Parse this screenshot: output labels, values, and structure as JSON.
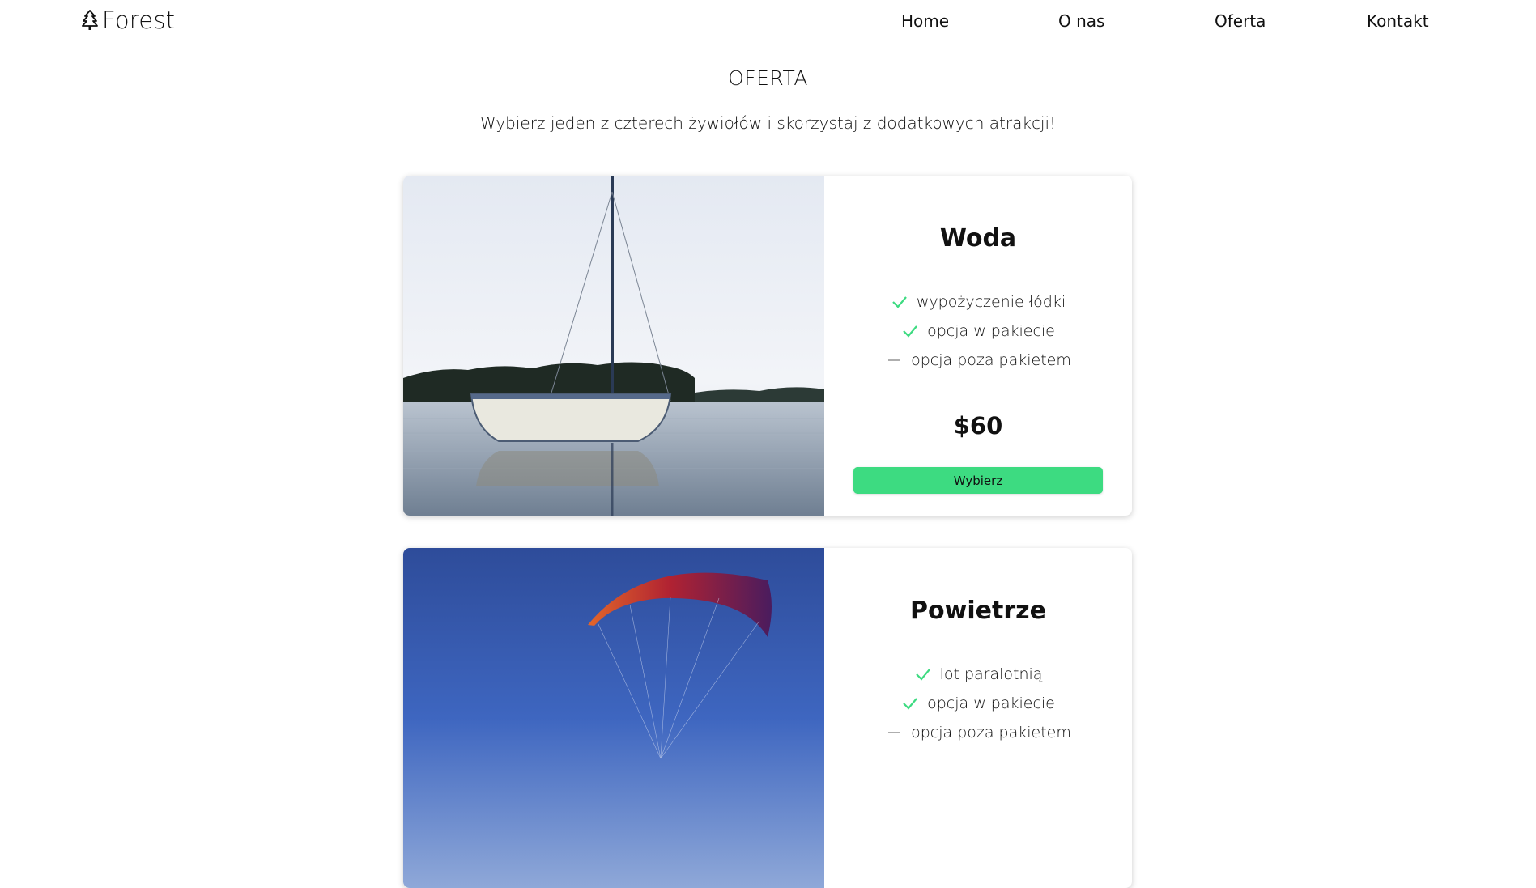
{
  "header": {
    "brand": "Forest",
    "brand_icon": "tree-icon",
    "nav": [
      "Home",
      "O nas",
      "Oferta",
      "Kontakt"
    ]
  },
  "section": {
    "title": "OFERTA",
    "subtitle": "Wybierz jeden z czterech żywiołów i skorzystaj z dodatkowych atrakcji!"
  },
  "colors": {
    "accent": "#3ddb81",
    "check": "#3ddb81",
    "dash": "#999999"
  },
  "offers": [
    {
      "title": "Woda",
      "image": "sailboat-on-lake-photo",
      "features": [
        {
          "icon": "check-icon",
          "text": "wypożyczenie łódki"
        },
        {
          "icon": "check-icon",
          "text": "opcja w pakiecie"
        },
        {
          "icon": "dash-icon",
          "text": "opcja poza pakietem"
        }
      ],
      "price": "$60",
      "button": "Wybierz"
    },
    {
      "title": "Powietrze",
      "image": "paraglider-in-sky-photo",
      "features": [
        {
          "icon": "check-icon",
          "text": "lot paralotnią"
        },
        {
          "icon": "check-icon",
          "text": "opcja w pakiecie"
        },
        {
          "icon": "dash-icon",
          "text": "opcja poza pakietem"
        }
      ]
    }
  ]
}
